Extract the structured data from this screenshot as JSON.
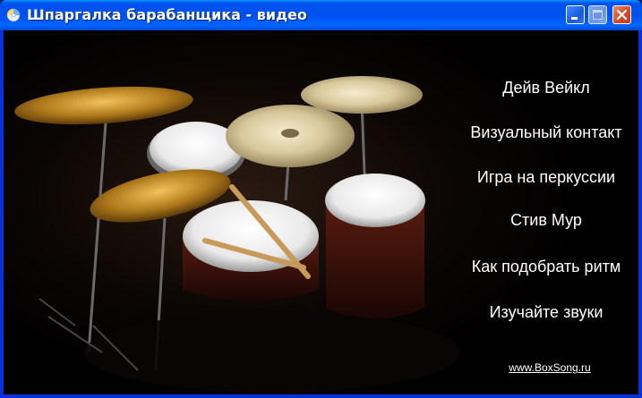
{
  "window": {
    "title": "Шпаргалка барабанщика - видео",
    "icon": "cd-icon"
  },
  "title_buttons": [
    "minimize",
    "maximize",
    "close"
  ],
  "menu": {
    "items": [
      {
        "label": "Дейв Вейкл"
      },
      {
        "label": "Визуальный контакт"
      },
      {
        "label": "Игра на перкуссии"
      },
      {
        "label": "Стив Мур"
      },
      {
        "label": "Как подобрать ритм"
      },
      {
        "label": "Изучайте звуки"
      }
    ]
  },
  "footer": {
    "link": "www.BoxSong.ru"
  },
  "colors": {
    "titlebar": "#0054e3",
    "background": "#000000",
    "menu_text": "#ffffff",
    "close_button": "#d8462a"
  }
}
